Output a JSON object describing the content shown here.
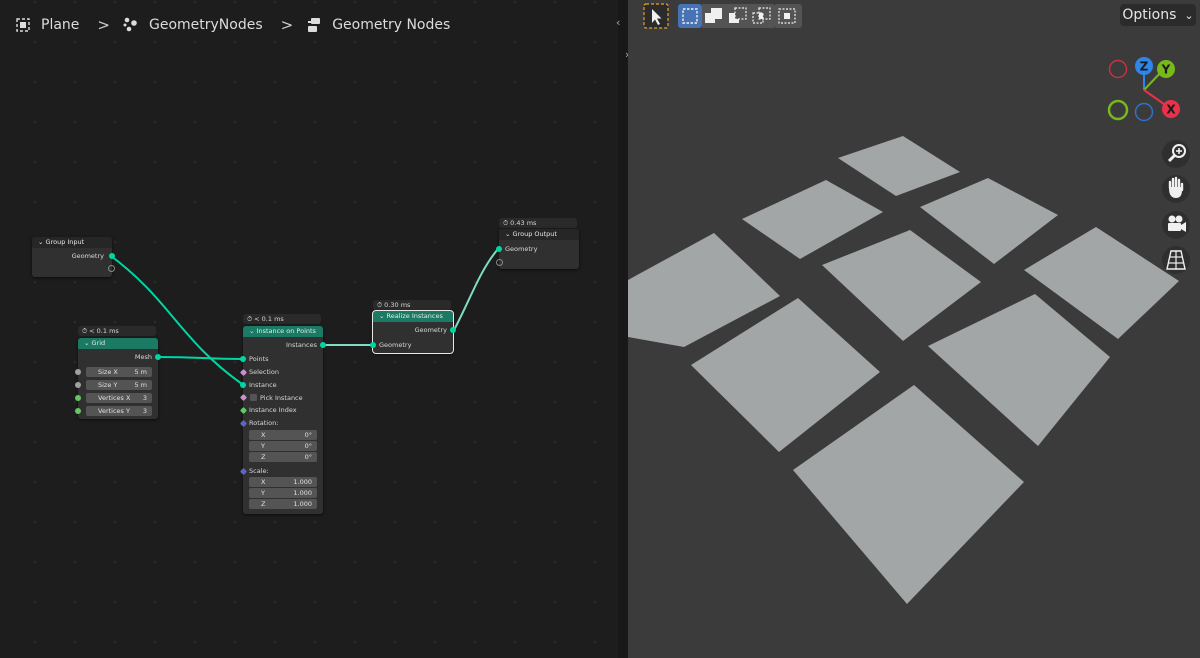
{
  "breadcrumb": {
    "items": [
      {
        "label": "Plane",
        "icon": "mesh-object-icon"
      },
      {
        "label": "GeometryNodes",
        "icon": "geometry-nodes-modifier-icon"
      },
      {
        "label": "Geometry Nodes",
        "icon": "node-tree-icon"
      }
    ],
    "separator": ">"
  },
  "nodes": {
    "group_input": {
      "title": "Group Input",
      "outputs": [
        "Geometry"
      ]
    },
    "grid": {
      "timing": "< 0.1 ms",
      "title": "Grid",
      "output": "Mesh",
      "fields": [
        {
          "label": "Size X",
          "value": "5 m"
        },
        {
          "label": "Size Y",
          "value": "5 m"
        },
        {
          "label": "Vertices X",
          "value": "3"
        },
        {
          "label": "Vertices Y",
          "value": "3"
        }
      ]
    },
    "instance_on_points": {
      "timing": "< 0.1 ms",
      "title": "Instance on Points",
      "output": "Instances",
      "inputs": [
        "Points",
        "Selection",
        "Instance",
        "Pick Instance",
        "Instance Index"
      ],
      "rotation_label": "Rotation:",
      "rotation": [
        {
          "axis": "X",
          "value": "0°"
        },
        {
          "axis": "Y",
          "value": "0°"
        },
        {
          "axis": "Z",
          "value": "0°"
        }
      ],
      "scale_label": "Scale:",
      "scale": [
        {
          "axis": "X",
          "value": "1.000"
        },
        {
          "axis": "Y",
          "value": "1.000"
        },
        {
          "axis": "Z",
          "value": "1.000"
        }
      ]
    },
    "realize_instances": {
      "timing": "0.30 ms",
      "title": "Realize Instances",
      "output": "Geometry",
      "input": "Geometry"
    },
    "group_output": {
      "timing": "0.43 ms",
      "title": "Group Output",
      "input": "Geometry"
    }
  },
  "viewport": {
    "options_label": "Options",
    "gizmo": {
      "z": "Z",
      "y": "Y",
      "x": "X"
    },
    "nav_icons": [
      "zoom-icon",
      "pan-hand-icon",
      "camera-icon",
      "perspective-grid-icon"
    ],
    "toolbar_icons": [
      "select-cursor-icon",
      "select-box-new-icon",
      "select-box-extend-icon",
      "select-box-subtract-icon",
      "select-box-intersect-icon"
    ]
  },
  "colors": {
    "editor_bg": "#1d1d1d",
    "viewport_bg": "#3b3b3b",
    "node_header_teal": "#1b7a63",
    "geometry_socket": "#00d6a3",
    "plane_color": "#a3a6a6",
    "axis_x": "#e8324a",
    "axis_y": "#77b81b",
    "axis_z": "#2e86e8"
  }
}
